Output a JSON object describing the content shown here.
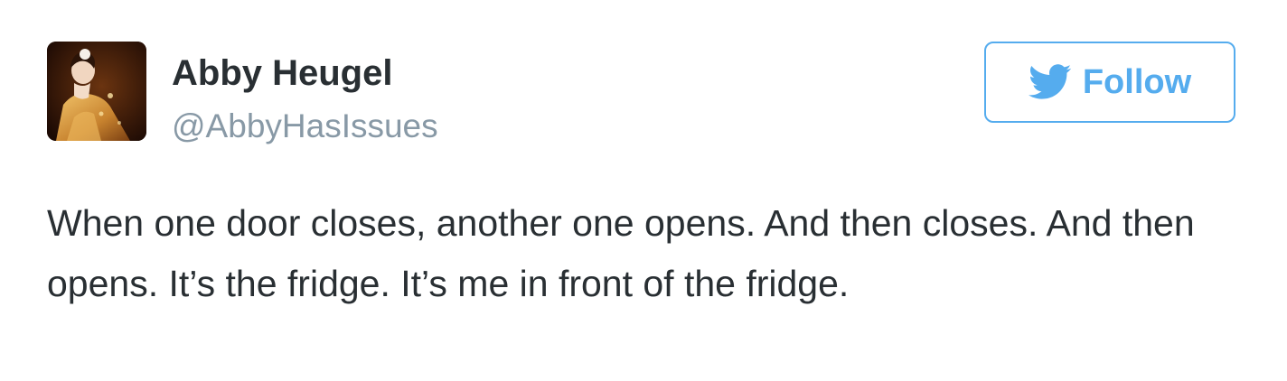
{
  "user": {
    "display_name": "Abby Heugel",
    "handle": "@AbbyHasIssues",
    "avatar_icon": "profile-photo"
  },
  "follow_button": {
    "label": "Follow",
    "icon": "twitter-bird-icon",
    "color": "#55acee"
  },
  "tweet": {
    "text": "When one door closes, another one opens. And then closes. And then opens. It’s the fridge. It’s me in front of the fridge."
  },
  "colors": {
    "text": "#292f33",
    "handle": "#8899a6",
    "accent": "#55acee"
  }
}
